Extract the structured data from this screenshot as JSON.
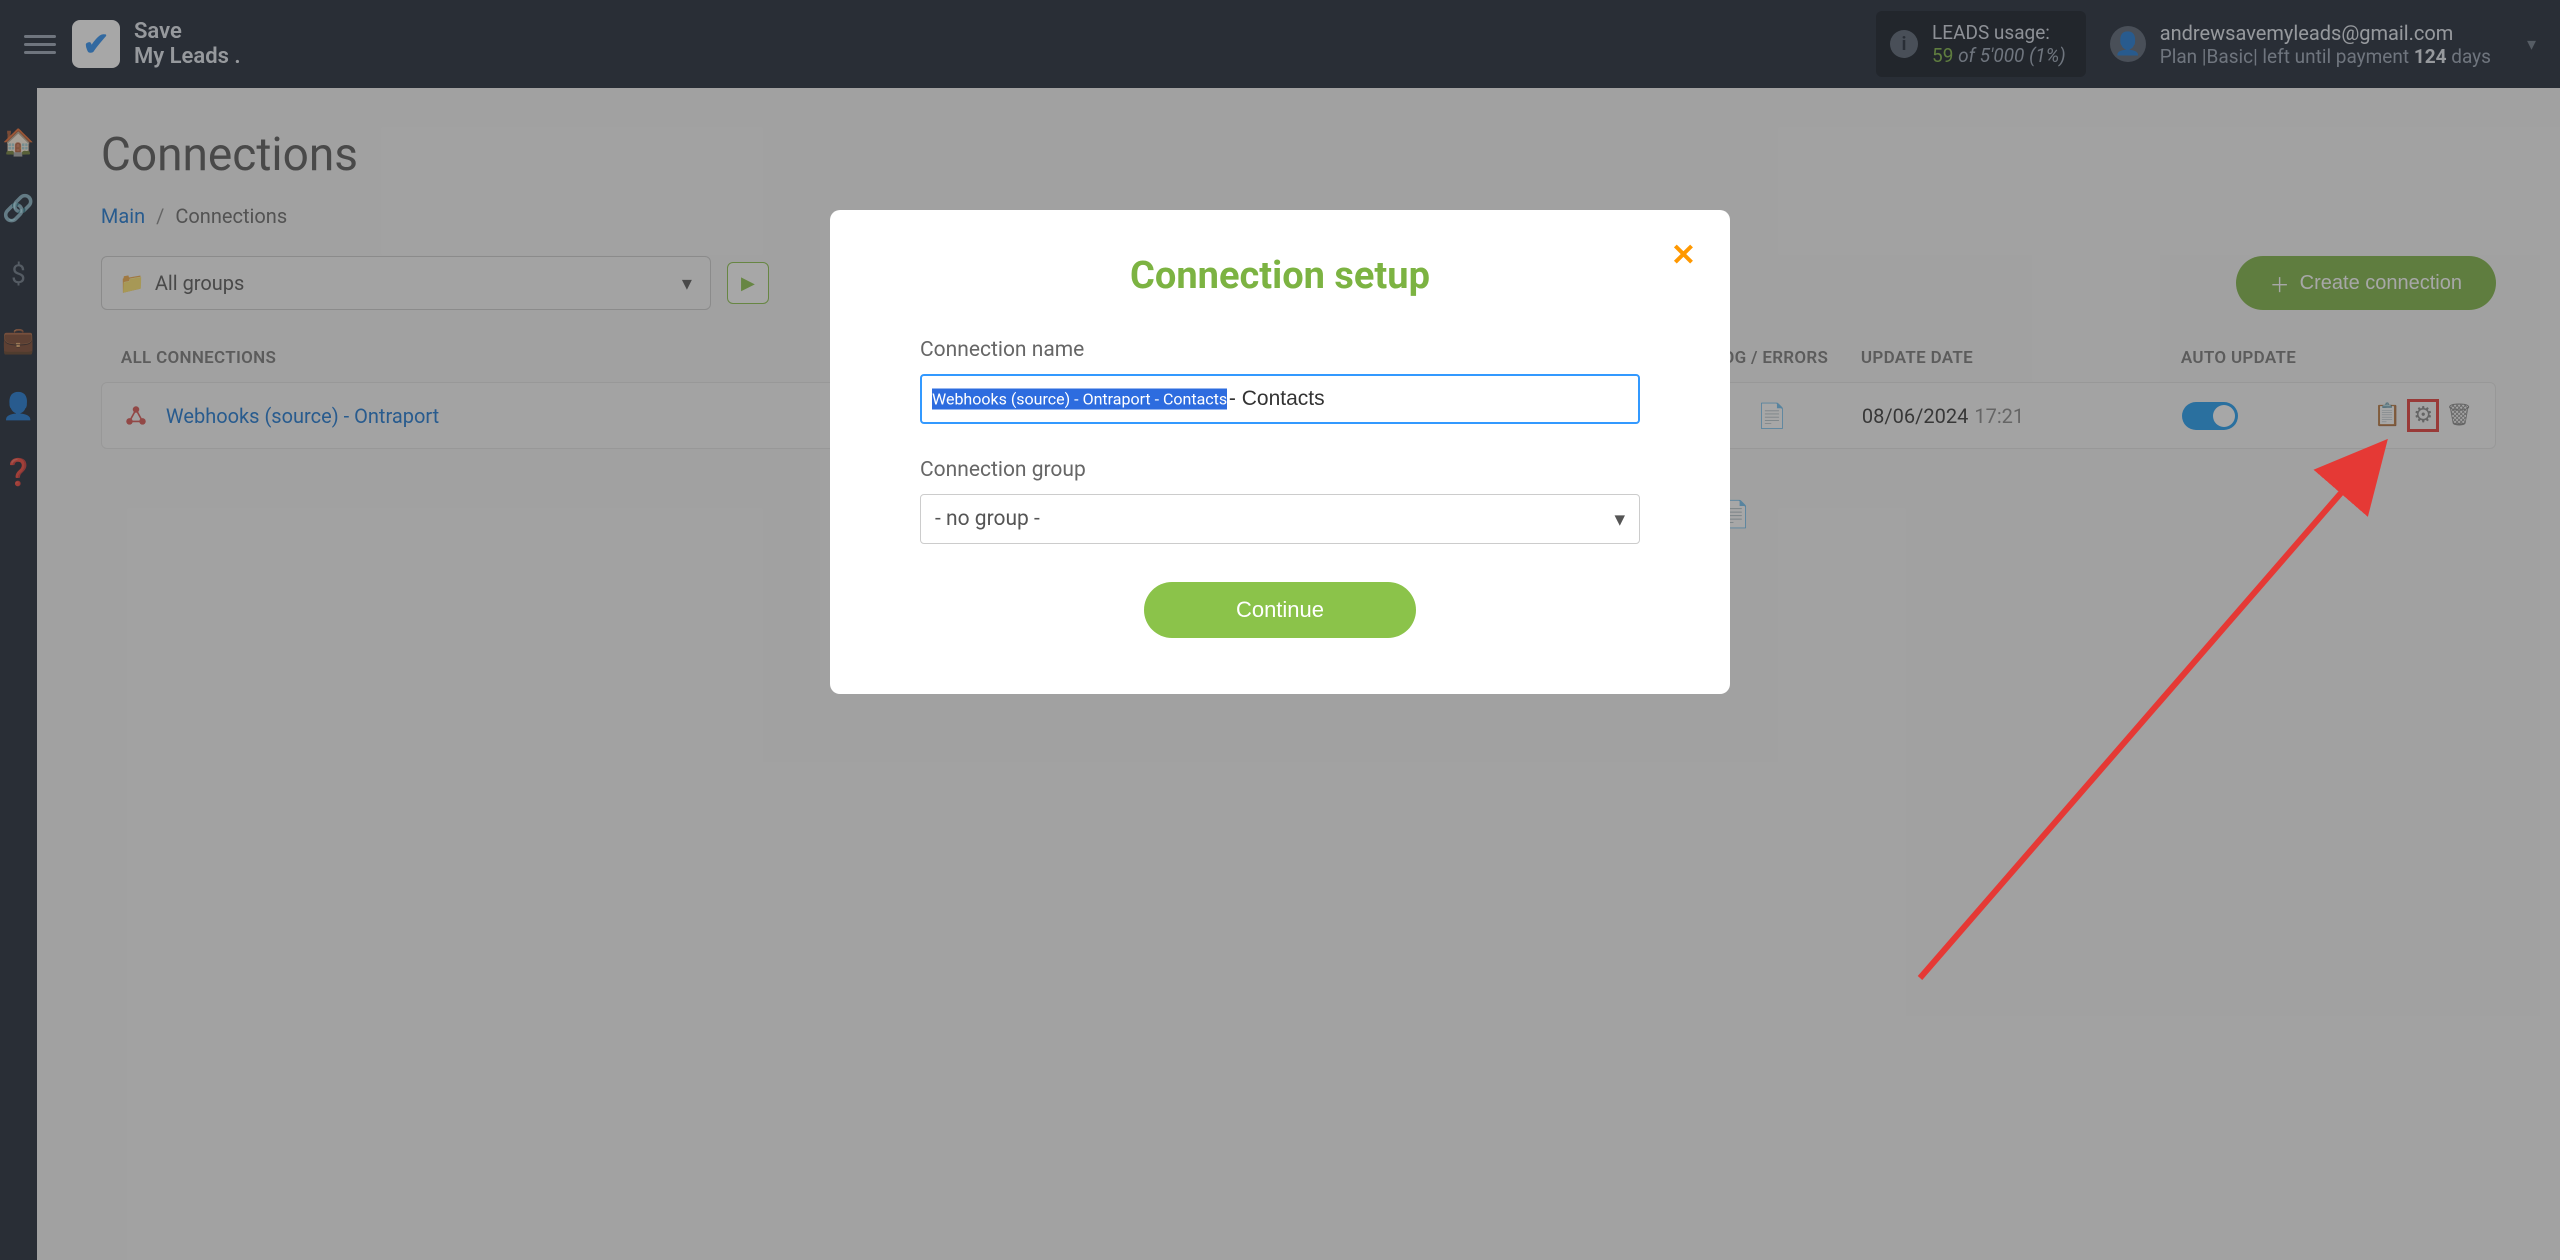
{
  "brand_line1": "Save",
  "brand_line2": "My Leads .",
  "usage": {
    "title": "LEADS usage:",
    "used": "59",
    "of_word": "of",
    "total": "5'000",
    "pct": "(1%)"
  },
  "account": {
    "email": "andrewsavemyleads@gmail.com",
    "plan_prefix": "Plan |",
    "plan_name": "Basic",
    "plan_mid": "| left until payment",
    "plan_days": "124",
    "plan_suffix": "days"
  },
  "page": {
    "title": "Connections",
    "breadcrumb_main": "Main",
    "breadcrumb_current": "Connections"
  },
  "toolbar": {
    "group_select": "All groups",
    "create_button": "Create connection"
  },
  "columns": {
    "all": "ALL CONNECTIONS",
    "log": "LOG / ERRORS",
    "update": "UPDATE DATE",
    "auto": "AUTO UPDATE"
  },
  "row": {
    "name": "Webhooks (source) - Ontraport",
    "date": "08/06/2024",
    "time": "17:21"
  },
  "modal": {
    "title": "Connection setup",
    "name_label": "Connection name",
    "name_value": "Webhooks (source) - Ontraport - Contacts",
    "group_label": "Connection group",
    "group_value": "- no group -",
    "continue": "Continue"
  }
}
